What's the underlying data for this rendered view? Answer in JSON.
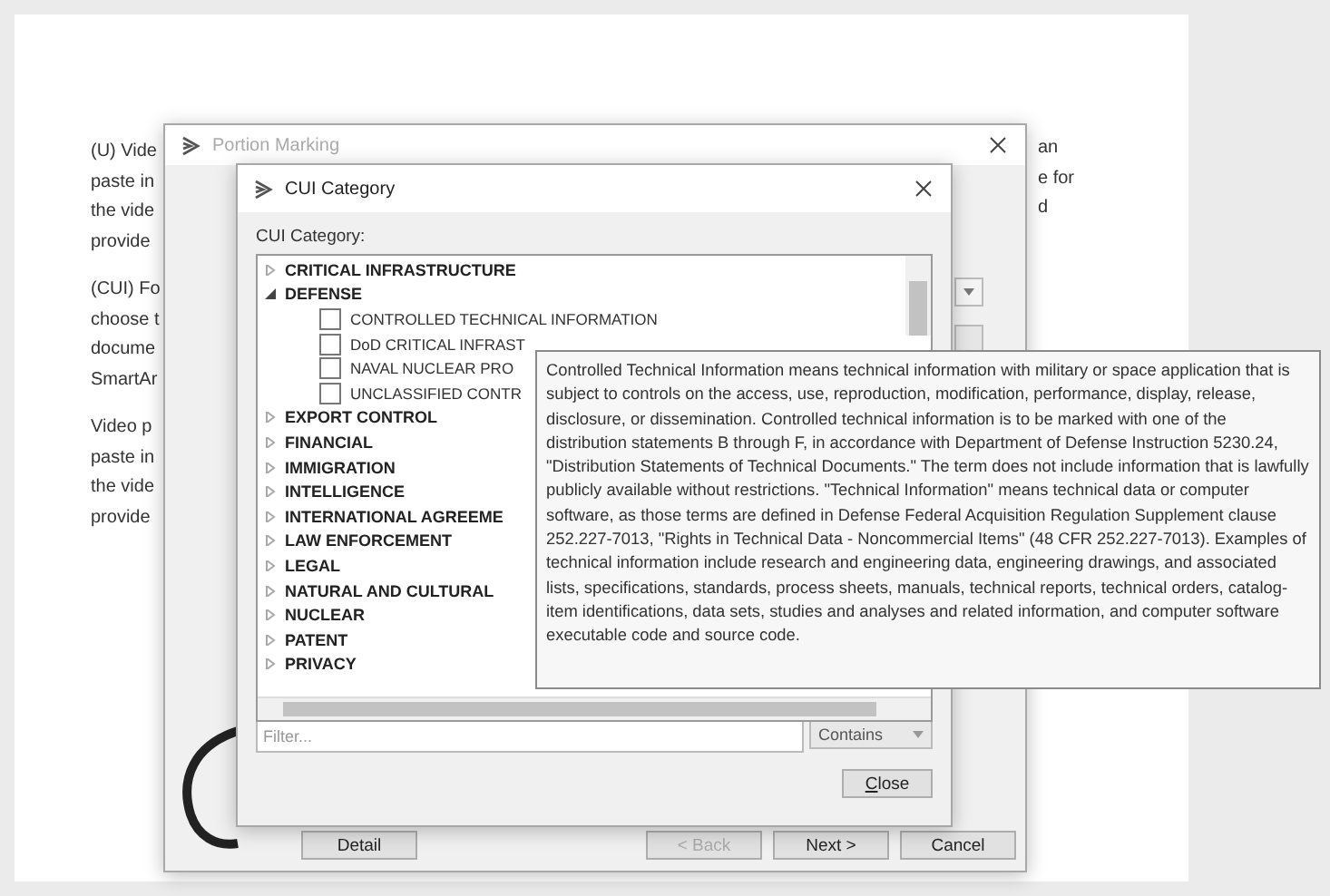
{
  "document": {
    "paragraphs": [
      {
        "lines": [
          "(U) Vide",
          "paste in",
          "the vide",
          "provide"
        ]
      },
      {
        "lines": [
          "(CUI) Fo",
          "choose t",
          "docume",
          "SmartAr"
        ]
      },
      {
        "lines": [
          "Video p",
          "paste in",
          "the vide",
          "provide"
        ]
      }
    ],
    "right_fragments": [
      "an",
      "e for",
      "d"
    ]
  },
  "portion_marking": {
    "title": "Portion Marking",
    "buttons": [
      {
        "label": "Detail",
        "disabled": false
      },
      {
        "label": "< Back",
        "disabled": true
      },
      {
        "label": "Next >",
        "disabled": false
      },
      {
        "label": "Cancel",
        "disabled": false
      }
    ]
  },
  "cui_category": {
    "title": "CUI Category",
    "label": "CUI Category:",
    "tree": [
      {
        "label": "CRITICAL INFRASTRUCTURE",
        "expanded": false
      },
      {
        "label": "DEFENSE",
        "expanded": true,
        "children": [
          {
            "label": "CONTROLLED TECHNICAL INFORMATION",
            "checked": false
          },
          {
            "label": "DoD CRITICAL INFRAST",
            "checked": false
          },
          {
            "label": "NAVAL NUCLEAR PRO",
            "checked": false
          },
          {
            "label": "UNCLASSIFIED CONTR",
            "checked": false
          }
        ]
      },
      {
        "label": "EXPORT CONTROL",
        "expanded": false
      },
      {
        "label": "FINANCIAL",
        "expanded": false
      },
      {
        "label": "IMMIGRATION",
        "expanded": false
      },
      {
        "label": "INTELLIGENCE",
        "expanded": false
      },
      {
        "label": "INTERNATIONAL AGREEME",
        "expanded": false
      },
      {
        "label": "LAW ENFORCEMENT",
        "expanded": false
      },
      {
        "label": "LEGAL",
        "expanded": false
      },
      {
        "label": "NATURAL AND CULTURAL",
        "expanded": false
      },
      {
        "label": "NUCLEAR",
        "expanded": false
      },
      {
        "label": "PATENT",
        "expanded": false
      },
      {
        "label": "PRIVACY",
        "expanded": false
      }
    ],
    "filter": {
      "placeholder": "Filter..."
    },
    "match_mode": "Contains",
    "close_button": "Close"
  },
  "tooltip": {
    "text": "Controlled Technical Information means technical information with military or space application that is subject to controls on the access, use, reproduction, modification, performance, display, release, disclosure, or dissemination. Controlled technical information is to be marked with one of the distribution statements B through F, in accordance with Department of Defense Instruction 5230.24, \"Distribution Statements of Technical Documents.\" The term does not include information that is lawfully publicly available without restrictions. \"Technical Information\" means technical data or computer software, as those terms are defined in Defense Federal Acquisition Regulation Supplement clause 252.227-7013, \"Rights in Technical Data - Noncommercial Items\" (48 CFR 252.227-7013). Examples of technical information include research and engineering data, engineering drawings, and associated lists, specifications, standards, process sheets, manuals, technical reports, technical orders, catalog-item identifications, data sets, studies and analyses and related information, and computer software executable code and source code."
  }
}
